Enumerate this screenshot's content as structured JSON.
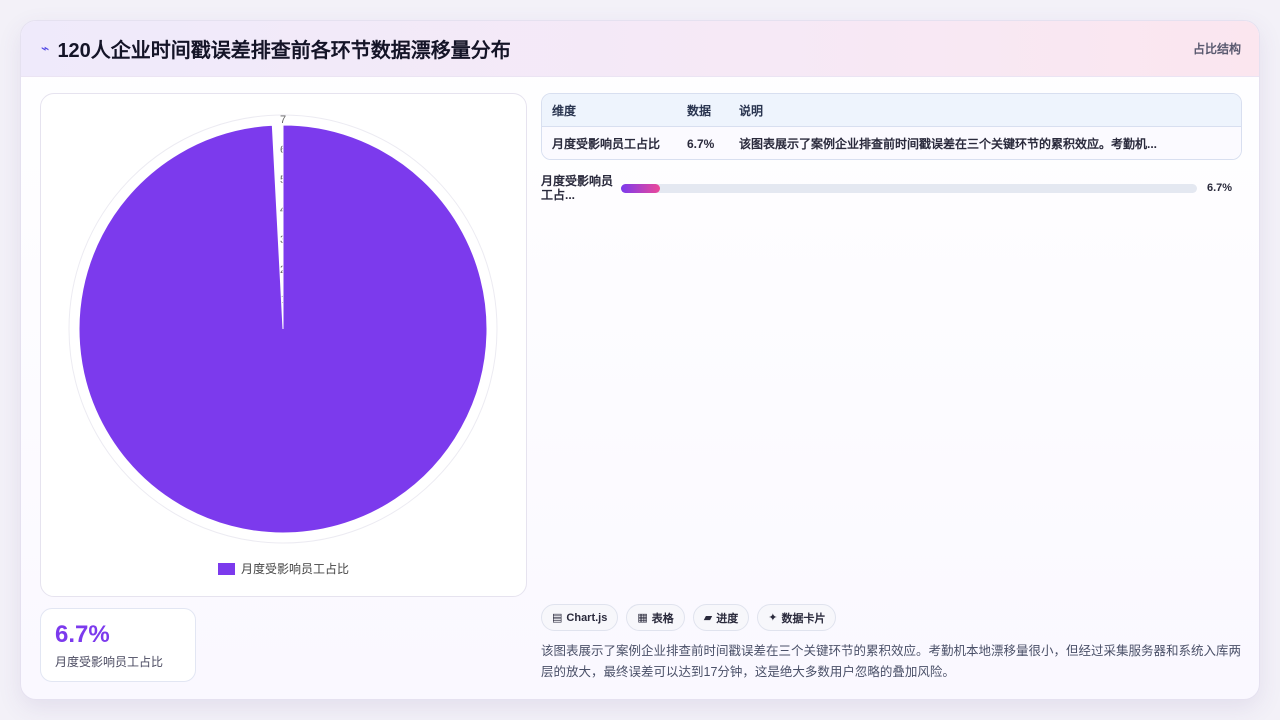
{
  "header": {
    "icon": "sparkline-icon",
    "title": "120人企业时间戳误差排查前各环节数据漂移量分布",
    "tag": "占比结构"
  },
  "chart_data": {
    "type": "pie",
    "categories": [
      "月度受影响员工占比"
    ],
    "values": [
      6.7
    ],
    "colors": [
      "#7c3aed"
    ],
    "legend": "bottom",
    "ticks": [
      "1",
      "2",
      "3",
      "4",
      "5",
      "6",
      "7"
    ]
  },
  "kpi": {
    "value": "6.7%",
    "label": "月度受影响员工占比"
  },
  "table": {
    "headers": [
      "维度",
      "数据",
      "说明"
    ],
    "rows": [
      [
        "月度受影响员工占比",
        "6.7%",
        "该图表展示了案例企业排查前时间戳误差在三个关键环节的累积效应。考勤机..."
      ]
    ]
  },
  "bars": [
    {
      "label": "月度受影响员工占...",
      "value_text": "6.7%",
      "fraction": 0.067
    }
  ],
  "chips": [
    {
      "icon": "chart-icon",
      "glyph": "▤",
      "label": "Chart.js"
    },
    {
      "icon": "table-icon",
      "glyph": "▦",
      "label": "表格"
    },
    {
      "icon": "progress-icon",
      "glyph": "▰",
      "label": "进度"
    },
    {
      "icon": "card-icon",
      "glyph": "✦",
      "label": "数据卡片"
    }
  ],
  "description": "该图表展示了案例企业排查前时间戳误差在三个关键环节的累积效应。考勤机本地漂移量很小，但经过采集服务器和系统入库两层的放大，最终误差可以达到17分钟，这是绝大多数用户忽略的叠加风险。"
}
